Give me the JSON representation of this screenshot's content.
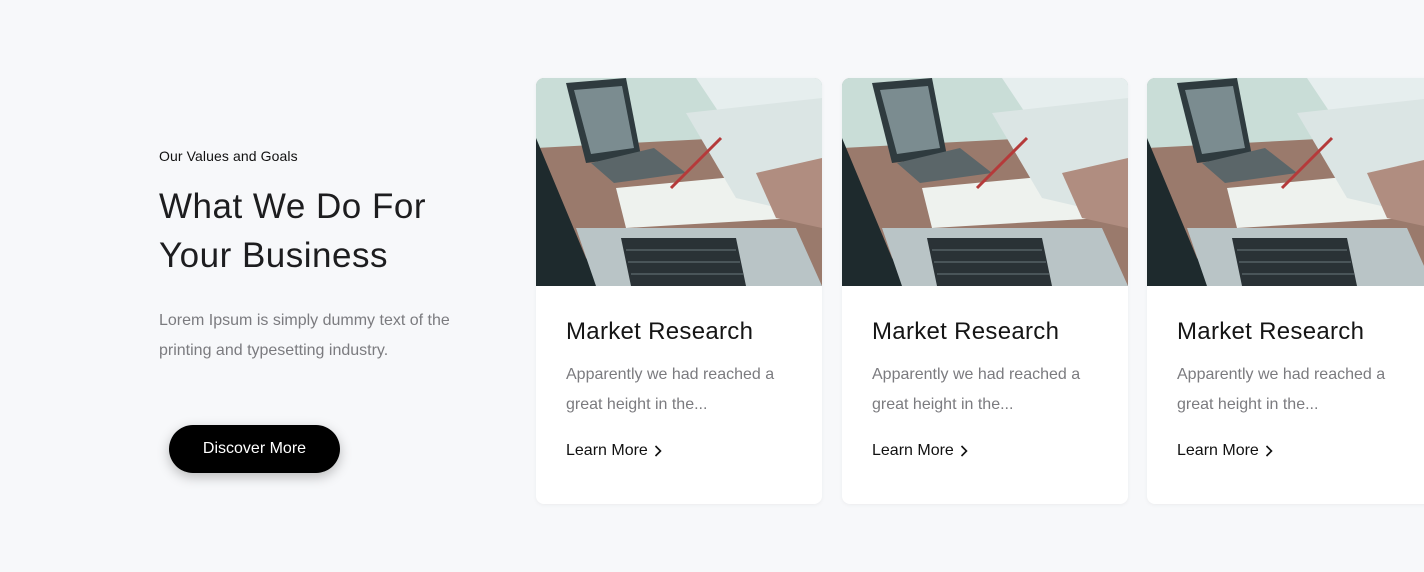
{
  "intro": {
    "eyebrow": "Our Values and Goals",
    "heading": "What We Do For Your Business",
    "lead": "Lorem Ipsum is simply dummy text of the printing and typesetting industry.",
    "cta_label": "Discover More"
  },
  "cards": [
    {
      "title": "Market Research",
      "text": "Apparently we had reached a great height in the...",
      "link": "Learn More",
      "link_icon": "chevron-right-icon",
      "image": "office-laptop-desk-photo"
    },
    {
      "title": "Market Research",
      "text": "Apparently we had reached a great height in the...",
      "link": "Learn More",
      "link_icon": "chevron-right-icon",
      "image": "office-laptop-desk-photo"
    },
    {
      "title": "Market Research",
      "text": "Apparently we had reached a great height in the...",
      "link": "Learn More",
      "link_icon": "chevron-right-icon",
      "image": "office-laptop-desk-photo"
    }
  ],
  "colors": {
    "background": "#f7f8fa",
    "card": "#ffffff",
    "button": "#000000",
    "heading": "#1d1d1f",
    "muted_text": "#7b7b7f"
  }
}
